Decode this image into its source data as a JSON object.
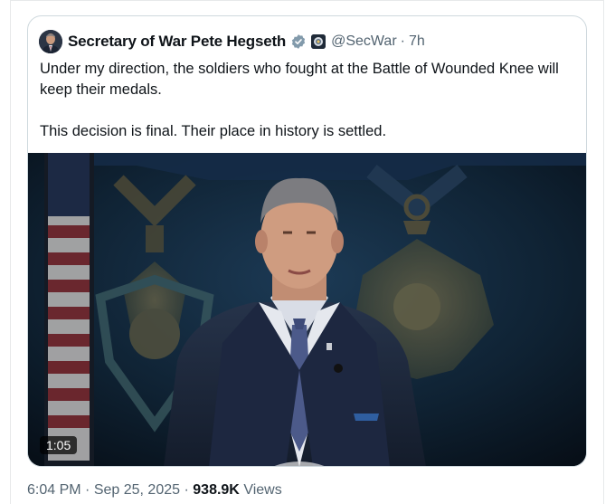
{
  "quoted_post": {
    "author_name": "Secretary of War Pete Hegseth",
    "handle": "@SecWar",
    "separator": "·",
    "time": "7h",
    "verified_icon": "verified-badge-icon",
    "affiliate_icon": "department-seal-icon",
    "text_lines": [
      "Under my direction, the soldiers who fought at the Battle of Wounded Knee will keep their medals.",
      "This decision is final. Their place in history is settled."
    ],
    "video": {
      "duration": "1:05"
    }
  },
  "post_meta": {
    "time": "6:04 PM",
    "separator_1": "·",
    "date": "Sep 25, 2025",
    "separator_2": "·",
    "views_count": "938.9K",
    "views_label": "Views"
  },
  "colors": {
    "text_primary": "#0f1419",
    "text_secondary": "#536471",
    "border": "#cfd9de",
    "verified": "#829aab"
  }
}
